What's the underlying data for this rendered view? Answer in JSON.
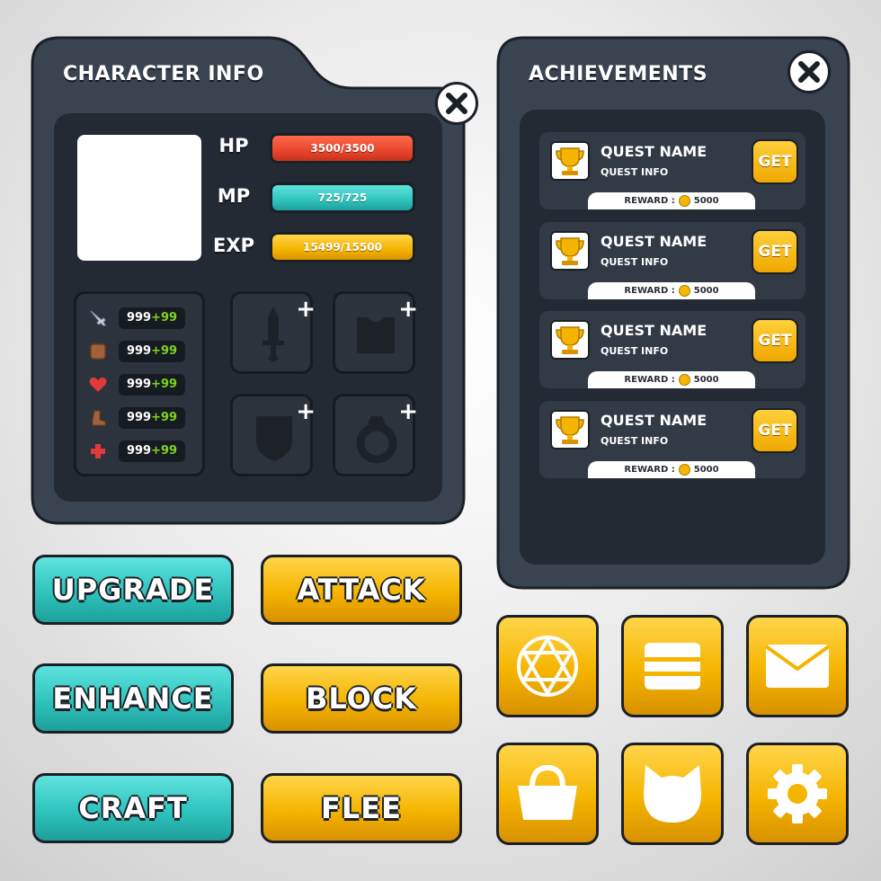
{
  "character_panel": {
    "title": "CHARACTER INFO",
    "hp": {
      "label": "HP",
      "value": "3500/3500",
      "color": "#e8452c"
    },
    "mp": {
      "label": "MP",
      "value": "725/725",
      "color": "#2fc3bd"
    },
    "exp": {
      "label": "EXP",
      "value": "15499/15500",
      "color": "#f5b400"
    },
    "stats": [
      {
        "icon": "sword-icon",
        "base": "999",
        "bonus": "+99"
      },
      {
        "icon": "shield-icon",
        "base": "999",
        "bonus": "+99"
      },
      {
        "icon": "heart-icon",
        "base": "999",
        "bonus": "+99"
      },
      {
        "icon": "boot-icon",
        "base": "999",
        "bonus": "+99"
      },
      {
        "icon": "health-cross-icon",
        "base": "999",
        "bonus": "+99"
      }
    ],
    "equipment_slots": [
      "sword-slot",
      "armor-slot",
      "shield-slot",
      "ring-slot"
    ]
  },
  "achievements_panel": {
    "title": "ACHIEVEMENTS",
    "quests": [
      {
        "name": "QUEST NAME",
        "info": "QUEST INFO",
        "get_label": "GET",
        "reward_label": "REWARD :",
        "reward_amount": "5000"
      },
      {
        "name": "QUEST NAME",
        "info": "QUEST INFO",
        "get_label": "GET",
        "reward_label": "REWARD :",
        "reward_amount": "5000"
      },
      {
        "name": "QUEST NAME",
        "info": "QUEST INFO",
        "get_label": "GET",
        "reward_label": "REWARD :",
        "reward_amount": "5000"
      },
      {
        "name": "QUEST NAME",
        "info": "QUEST INFO",
        "get_label": "GET",
        "reward_label": "REWARD :",
        "reward_amount": "5000"
      }
    ]
  },
  "buttons": {
    "upgrade": "UPGRADE",
    "enhance": "ENHANCE",
    "craft": "CRAFT",
    "attack": "ATTACK",
    "block": "BLOCK",
    "flee": "FLEE"
  },
  "icon_buttons": [
    "hexagram-icon",
    "chest-icon",
    "mail-icon",
    "basket-icon",
    "cat-icon",
    "gear-icon"
  ]
}
